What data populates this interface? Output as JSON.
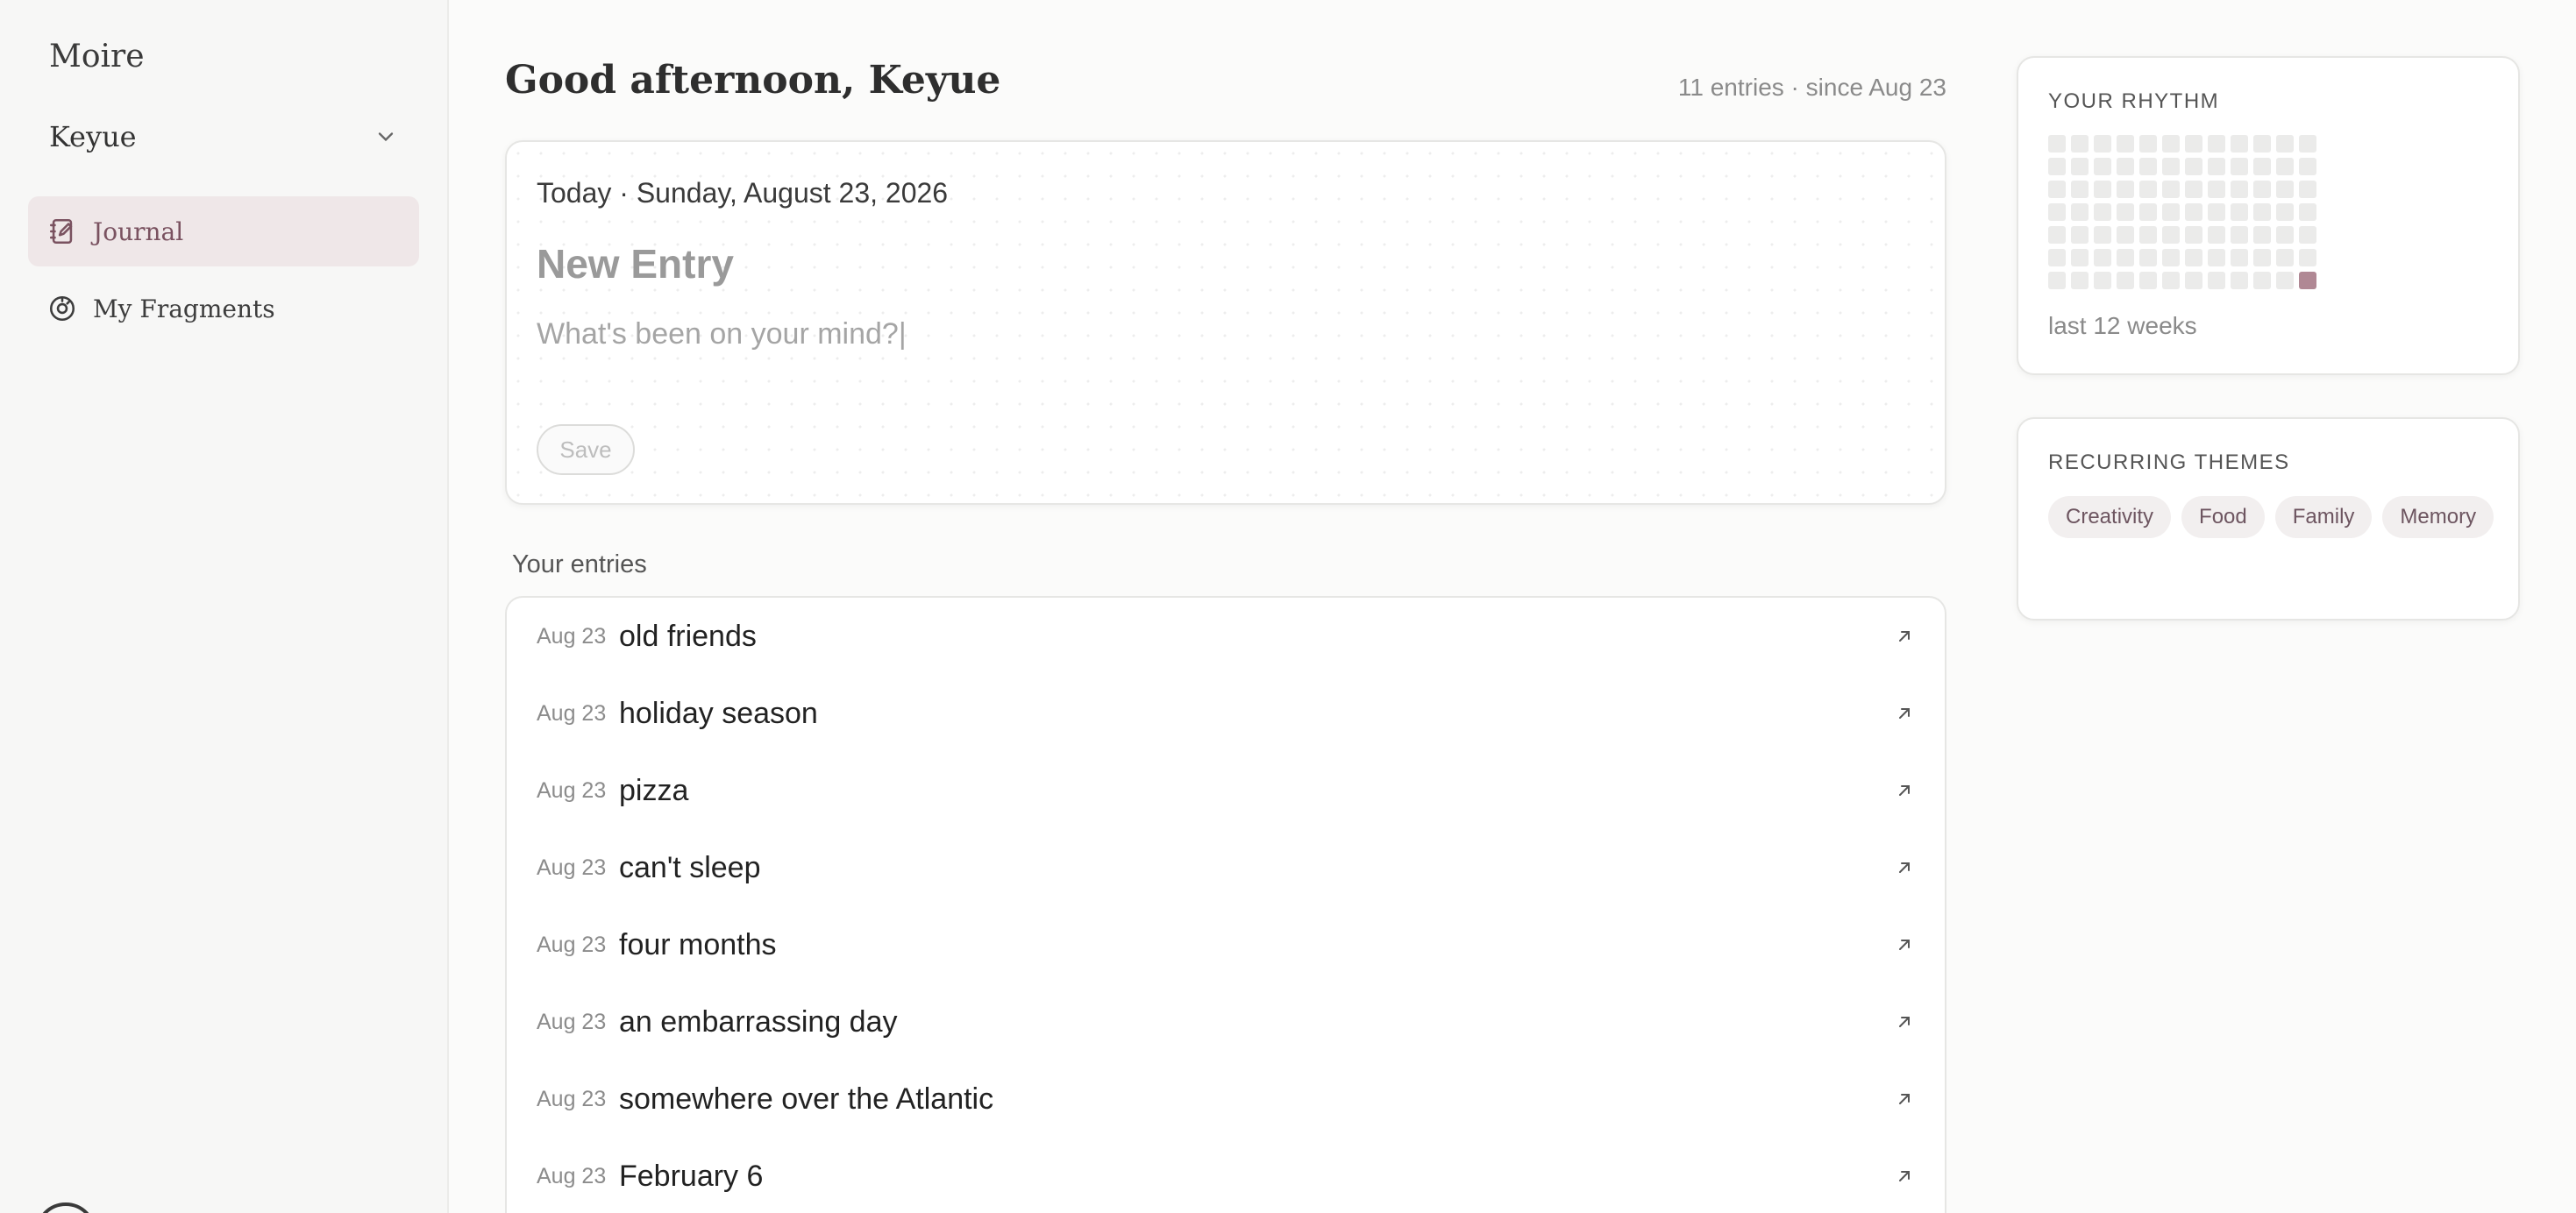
{
  "sidebar": {
    "brand": "Moire",
    "user": "Keyue",
    "nav": [
      {
        "label": "Journal",
        "icon": "journal-icon",
        "active": true
      },
      {
        "label": "My Fragments",
        "icon": "fragments-icon",
        "active": false
      }
    ]
  },
  "header": {
    "greeting": "Good afternoon, Keyue",
    "meta": "11 entries · since Aug 23"
  },
  "composer": {
    "date": "Today · Sunday, August 23, 2026",
    "title_placeholder": "New Entry",
    "body_placeholder": "What's been on your mind?|",
    "save_label": "Save"
  },
  "entries_section": {
    "title": "Your entries",
    "items": [
      {
        "date": "Aug 23",
        "title": "old friends"
      },
      {
        "date": "Aug 23",
        "title": "holiday season"
      },
      {
        "date": "Aug 23",
        "title": "pizza"
      },
      {
        "date": "Aug 23",
        "title": "can't sleep"
      },
      {
        "date": "Aug 23",
        "title": "four months"
      },
      {
        "date": "Aug 23",
        "title": "an embarrassing day"
      },
      {
        "date": "Aug 23",
        "title": "somewhere over the Atlantic"
      },
      {
        "date": "Aug 23",
        "title": "February 6"
      }
    ]
  },
  "rhythm": {
    "title": "YOUR RHYTHM",
    "caption": "last 12 weeks",
    "weeks": 12,
    "days": 7,
    "active_cells": [
      {
        "week": 12,
        "day": 7
      }
    ],
    "active_color": "#b08894"
  },
  "themes": {
    "title": "RECURRING THEMES",
    "tags": [
      "Creativity",
      "Food",
      "Family",
      "Memory"
    ]
  },
  "colors": {
    "accent": "#7a5260",
    "active_nav_bg": "#efe7e8"
  }
}
